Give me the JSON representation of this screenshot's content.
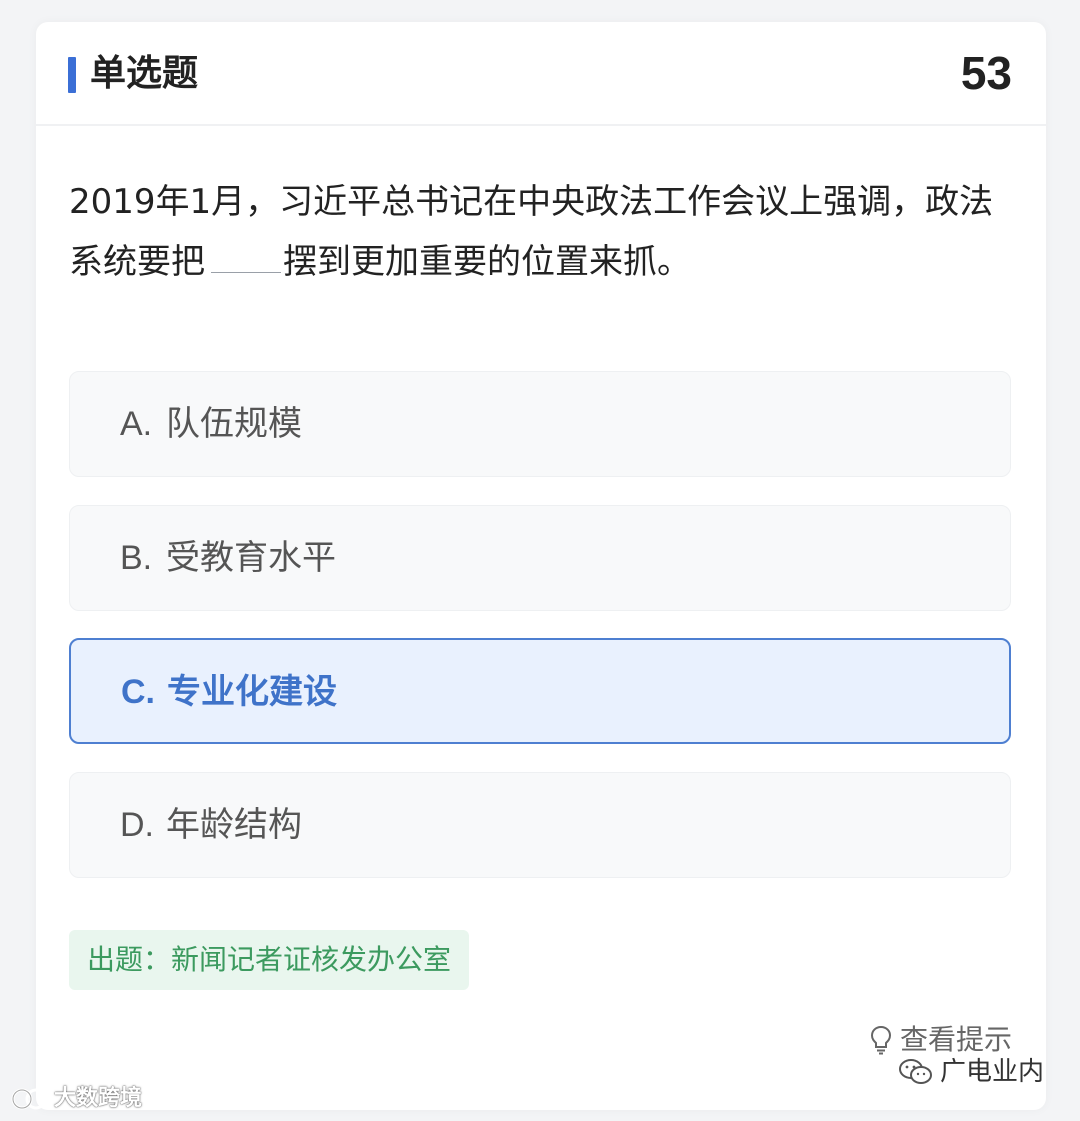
{
  "header": {
    "title": "单选题",
    "question_number": "53"
  },
  "question": {
    "text_before_blank": "2019年1月，习近平总书记在中央政法工作会议上强调，政法系统要把",
    "text_after_blank": "摆到更加重要的位置来抓。"
  },
  "options": [
    {
      "letter": "A.",
      "text": "队伍规模",
      "selected": false
    },
    {
      "letter": "B.",
      "text": "受教育水平",
      "selected": false
    },
    {
      "letter": "C.",
      "text": "专业化建设",
      "selected": true
    },
    {
      "letter": "D.",
      "text": "年龄结构",
      "selected": false
    }
  ],
  "source": {
    "label": "出题：新闻记者证核发办公室"
  },
  "hint": {
    "label": "查看提示",
    "icon": "lightbulb-icon"
  },
  "watermarks": {
    "left": "大数跨境",
    "right": "广电业内"
  },
  "colors": {
    "accent": "#3b6fd6",
    "selected_text": "#3f73c9",
    "selected_bg": "#e9f1fe",
    "selected_border": "#4e7fd1",
    "source_text": "#3c9a5f",
    "source_bg": "#e9f6ee"
  }
}
